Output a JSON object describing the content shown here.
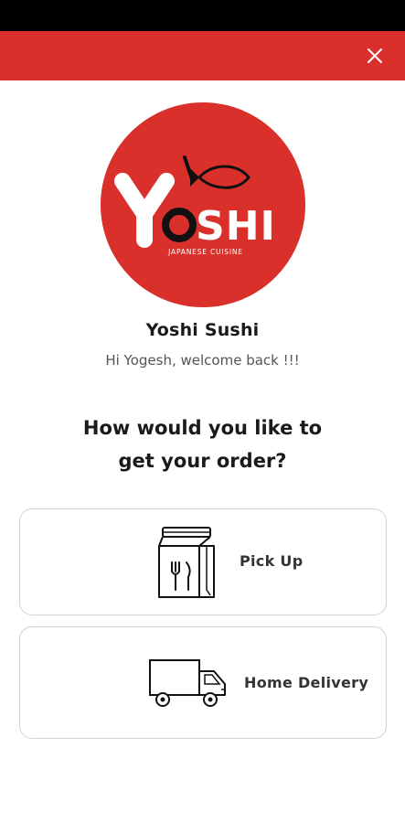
{
  "header": {
    "close_icon": "close-icon",
    "bar_color": "#d9302c"
  },
  "logo": {
    "brand_text": "YOSHI",
    "tagline": "JAPANESE CUISINE",
    "background": "#d9302c"
  },
  "store": {
    "name": "Yoshi Sushi",
    "welcome": "Hi Yogesh, welcome back !!!"
  },
  "question": {
    "line1": "How would you like to",
    "line2": "get your order?"
  },
  "options": [
    {
      "label": "Pick Up",
      "icon": "takeout-bag-icon"
    },
    {
      "label": "Home Delivery",
      "icon": "delivery-truck-icon"
    }
  ]
}
